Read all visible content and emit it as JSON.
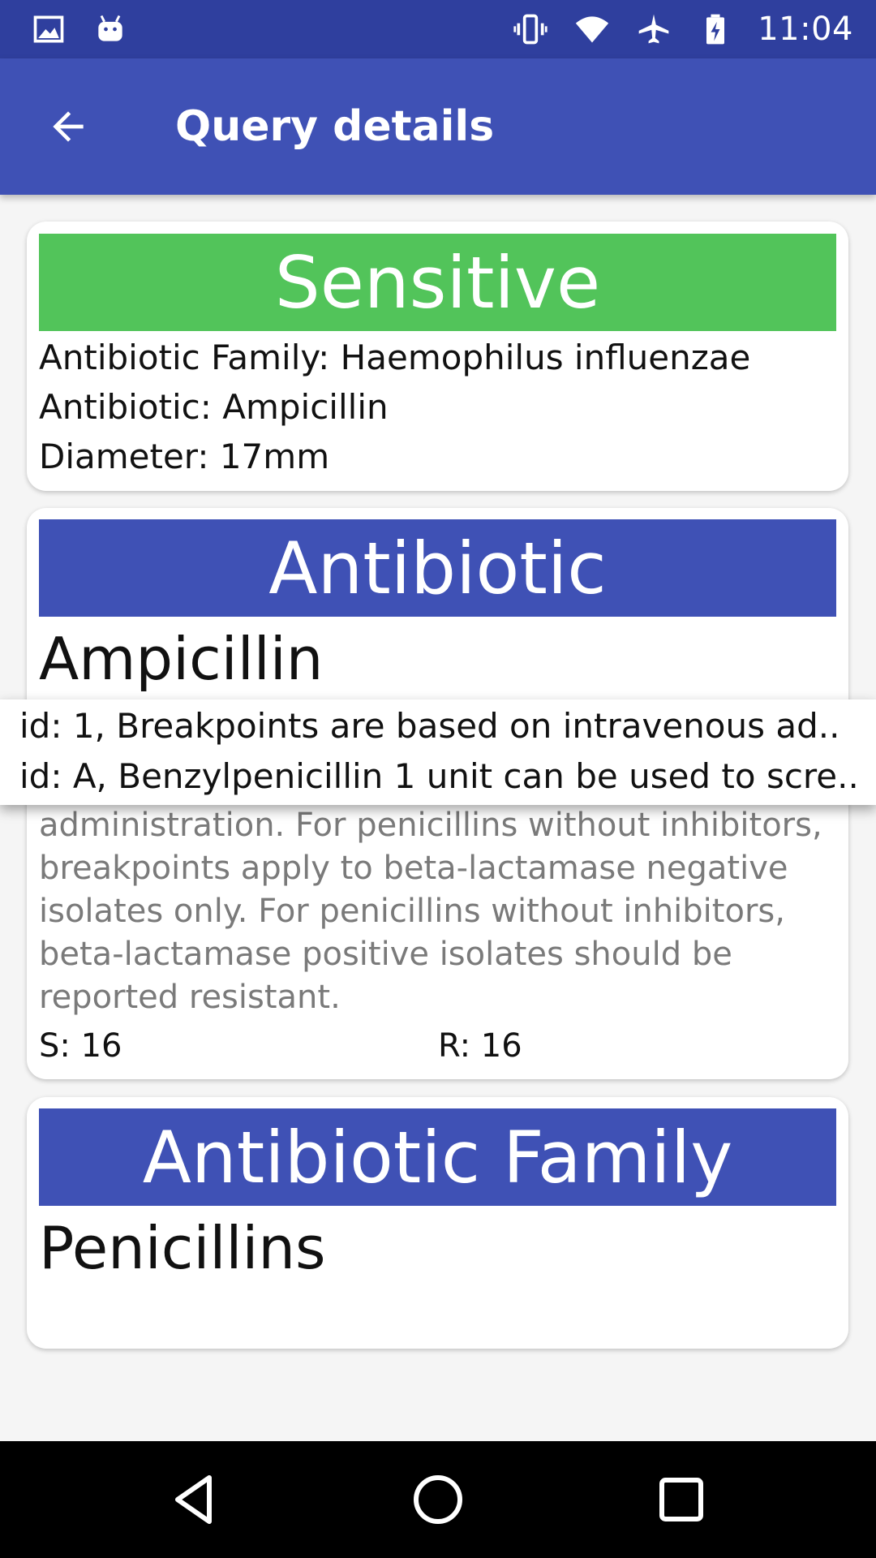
{
  "status_bar": {
    "time": "11:04",
    "icons_left": [
      "image-icon",
      "android-icon"
    ],
    "icons_right": [
      "vibrate-icon",
      "wifi-icon",
      "airplane-icon",
      "battery-charging-icon"
    ]
  },
  "app_bar": {
    "title": "Query details",
    "back_icon": "arrow-back-icon"
  },
  "result_card": {
    "status": "Sensitive",
    "status_color": "#52c45a",
    "family_line": "Antibiotic Family: Haemophilus influenzae",
    "antibiotic_line": "Antibiotic: Ampicillin",
    "diameter_line": "Diameter: 17mm"
  },
  "antibiotic_card": {
    "header": "Antibiotic",
    "name": "Ampicillin",
    "notes": "administration. For penicillins without inhibitors, breakpoints apply to beta-lactamase negative isolates only. For penicillins without inhibitors, beta-lactamase positive isolates should be reported resistant.",
    "s_value": "S: 16",
    "r_value": "R: 16"
  },
  "popup": {
    "items": [
      "id: 1, Breakpoints are based on intravenous ad..",
      "id: A, Benzylpenicillin 1 unit can be used to scre.."
    ]
  },
  "family_card": {
    "header": "Antibiotic Family",
    "name": "Penicillins"
  },
  "colors": {
    "status_bar": "#2f3f9e",
    "app_bar": "#3f51b5",
    "band_blue": "#3f51b5",
    "band_green": "#52c45a"
  },
  "nav_bar": {
    "icons": [
      "back-triangle-icon",
      "home-circle-icon",
      "recents-square-icon"
    ]
  }
}
